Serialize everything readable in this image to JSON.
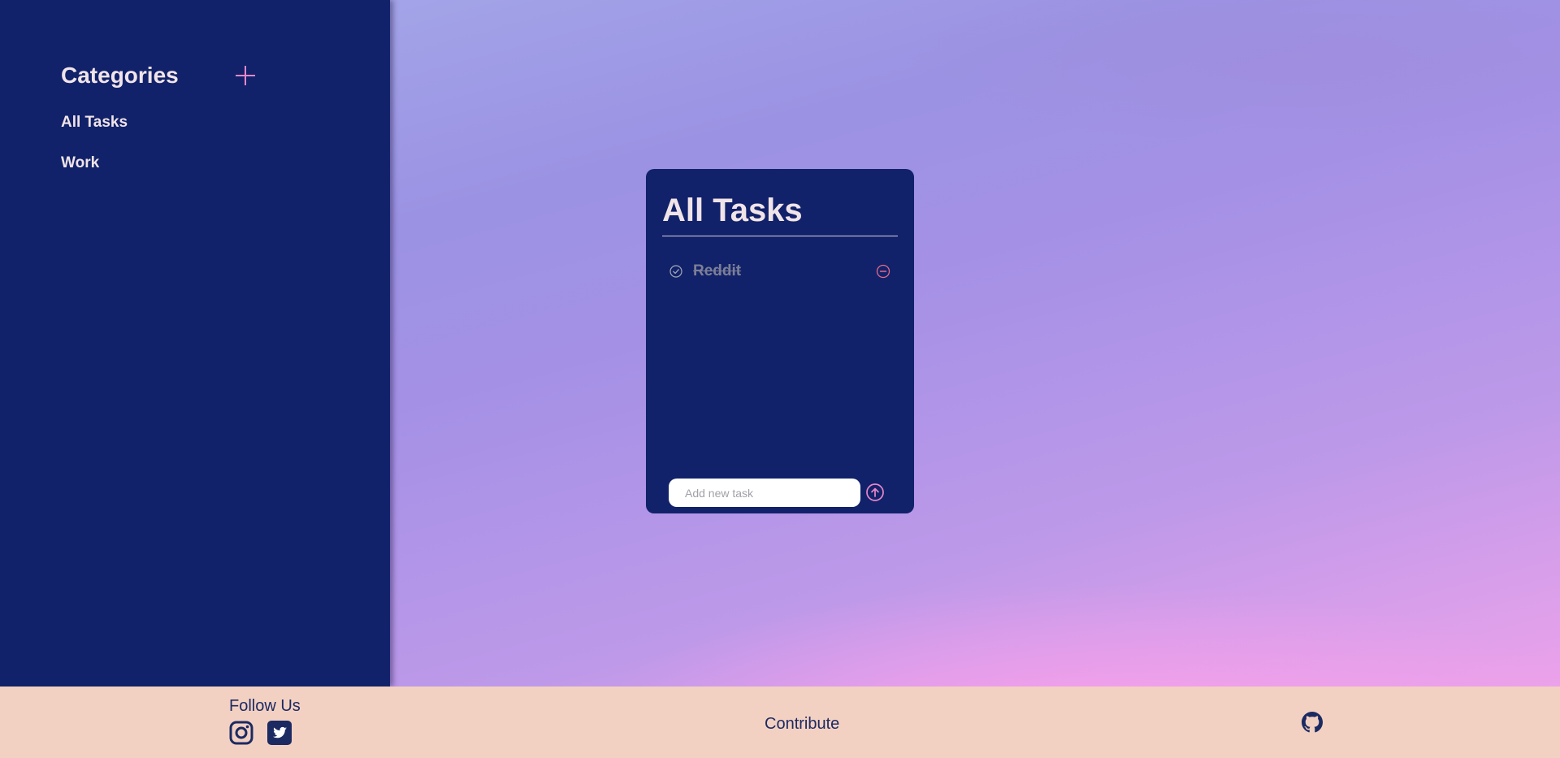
{
  "sidebar": {
    "title": "Categories",
    "add_icon": "plus-icon",
    "categories": [
      {
        "label": "All Tasks"
      },
      {
        "label": "Work"
      }
    ]
  },
  "task_panel": {
    "title": "All Tasks",
    "tasks": [
      {
        "label": "Reddit",
        "completed": true
      }
    ],
    "input": {
      "placeholder": "Add new task",
      "value": ""
    },
    "icons": {
      "check": "check-circle-icon",
      "remove": "minus-circle-icon",
      "submit": "arrow-up-circle-icon"
    }
  },
  "footer": {
    "follow_label": "Follow Us",
    "social_icons": [
      "instagram-icon",
      "twitter-icon"
    ],
    "contribute_label": "Contribute",
    "github_icon": "github-icon"
  },
  "colors": {
    "panel": "#11226a",
    "accent": "#e987c9",
    "footer": "#f3d1c2",
    "text_light": "#f1e4e8",
    "text_dark": "#1c2a62"
  }
}
